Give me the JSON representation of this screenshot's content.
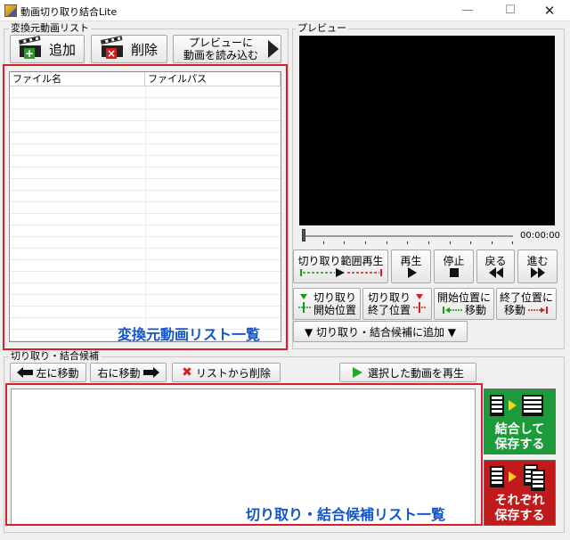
{
  "window": {
    "title": "動画切り取り結合Lite",
    "minimize": "—",
    "maximize": "☐",
    "close": "✕"
  },
  "source_group": {
    "legend": "変換元動画リスト",
    "add_button": "追加",
    "delete_button": "削除",
    "preview_load_line1": "プレビューに",
    "preview_load_line2": "動画を読み込む",
    "columns": [
      "ファイル名",
      "ファイルパス"
    ],
    "overlay_label": "変換元動画リスト一覧"
  },
  "preview": {
    "legend": "プレビュー",
    "timecode": "00:00:00",
    "range_play": "切り取り範囲再生",
    "play": "再生",
    "stop": "停止",
    "back": "戻る",
    "forward": "進む",
    "cut_start_line1": "切り取り",
    "cut_start_line2": "開始位置",
    "cut_end_line1": "切り取り",
    "cut_end_line2": "終了位置",
    "move_start_line1": "開始位置に",
    "move_start_line2": "移動",
    "move_end_line1": "終了位置に",
    "move_end_line2": "移動",
    "add_to_candidates": "▼ 切り取り・結合候補に追加 ▼"
  },
  "candidates_group": {
    "legend": "切り取り・結合候補",
    "move_left": "左に移動",
    "move_right": "右に移動",
    "remove_from_list": "リストから削除",
    "play_selected": "選択した動画を再生",
    "overlay_label": "切り取り・結合候補リスト一覧"
  },
  "save_buttons": {
    "join_line1": "結合して",
    "join_line2": "保存する",
    "each_line1": "それぞれ",
    "each_line2": "保存する"
  },
  "colors": {
    "annotation_red": "#d3222a",
    "label_blue": "#1155cc",
    "join_green": "#1d9a3a",
    "each_red": "#c01a1a"
  }
}
